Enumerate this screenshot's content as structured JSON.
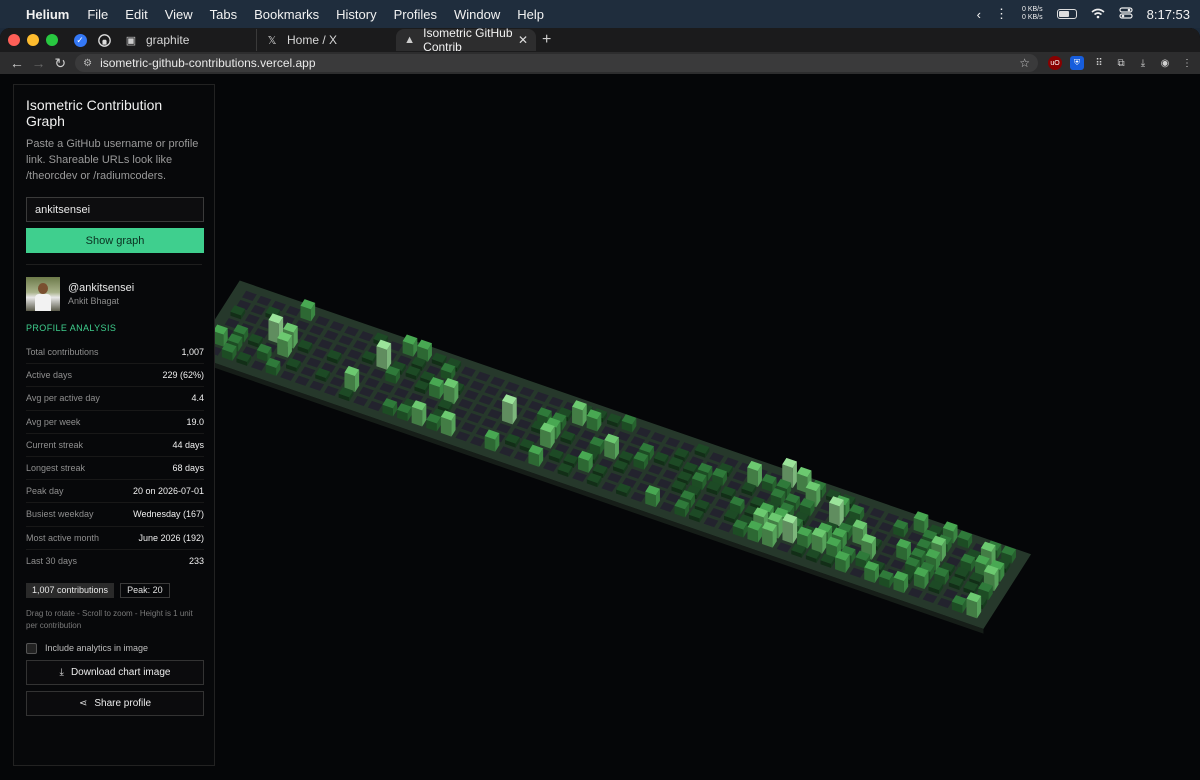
{
  "menubar": {
    "app": "Helium",
    "items": [
      "File",
      "Edit",
      "View",
      "Tabs",
      "Bookmarks",
      "History",
      "Profiles",
      "Window",
      "Help"
    ],
    "net_up": "0 KB/s",
    "net_down": "0 KB/s",
    "time": "8:17:53"
  },
  "tabs": [
    {
      "title": "graphite",
      "icon": "graphite-icon"
    },
    {
      "title": "Home / X",
      "icon": "x-logo-icon"
    },
    {
      "title": "Isometric GitHub Contrib",
      "icon": "vercel-icon",
      "active": true
    }
  ],
  "url": "isometric-github-contributions.vercel.app",
  "panel": {
    "title": "Isometric Contribution Graph",
    "description": "Paste a GitHub username or profile link. Shareable URLs look like /theorcdev or /radiumcoders.",
    "username_value": "ankitsensei",
    "show_graph_label": "Show graph",
    "handle": "@ankitsensei",
    "full_name": "Ankit Bhagat",
    "section_title": "PROFILE ANALYSIS",
    "stats": [
      {
        "label": "Total contributions",
        "value": "1,007"
      },
      {
        "label": "Active days",
        "value": "229 (62%)"
      },
      {
        "label": "Avg per active day",
        "value": "4.4"
      },
      {
        "label": "Avg per week",
        "value": "19.0"
      },
      {
        "label": "Current streak",
        "value": "44 days"
      },
      {
        "label": "Longest streak",
        "value": "68 days"
      },
      {
        "label": "Peak day",
        "value": "20 on 2026-07-01"
      },
      {
        "label": "Busiest weekday",
        "value": "Wednesday (167)"
      },
      {
        "label": "Most active month",
        "value": "June 2026 (192)"
      },
      {
        "label": "Last 30 days",
        "value": "233"
      }
    ],
    "badge_contributions": "1,007 contributions",
    "badge_peak": "Peak: 20",
    "hint": "Drag to rotate - Scroll to zoom - Height is 1 unit per contribution",
    "checkbox_label": "Include analytics in image",
    "download_label": "Download chart image",
    "share_label": "Share profile"
  },
  "colors": {
    "accent": "#3fcf8e",
    "cell_empty": "#23232e",
    "levels": [
      "#1d4a25",
      "#2f7a3a",
      "#48a852",
      "#6cc970",
      "#9be39a"
    ]
  }
}
